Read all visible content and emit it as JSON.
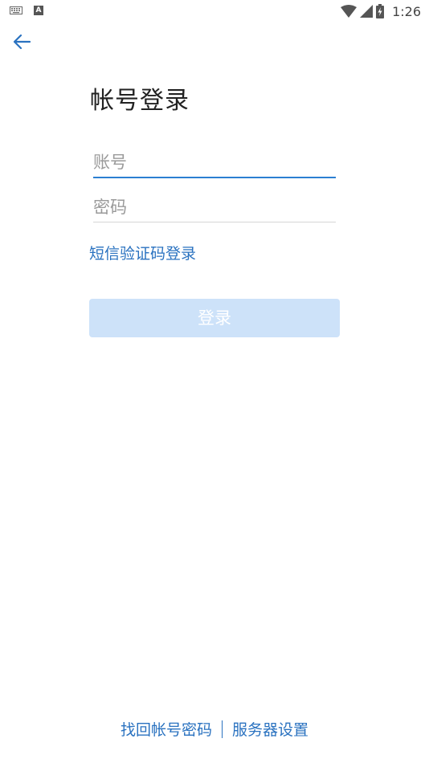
{
  "status_bar": {
    "time": "1:26",
    "icons": [
      "keyboard-icon",
      "text-input-icon",
      "wifi-icon",
      "signal-icon",
      "battery-charging-icon"
    ]
  },
  "header": {
    "back_icon": "arrow-left-icon"
  },
  "title": "帐号登录",
  "form": {
    "account_placeholder": "账号",
    "account_value": "",
    "password_placeholder": "密码",
    "password_value": ""
  },
  "sms_login_label": "短信验证码登录",
  "login_button_label": "登录",
  "footer": {
    "find_password_label": "找回帐号密码",
    "server_settings_label": "服务器设置"
  },
  "colors": {
    "accent": "#2c7fd2",
    "link": "#2a72c0",
    "button_disabled_bg": "#cde2f9"
  }
}
